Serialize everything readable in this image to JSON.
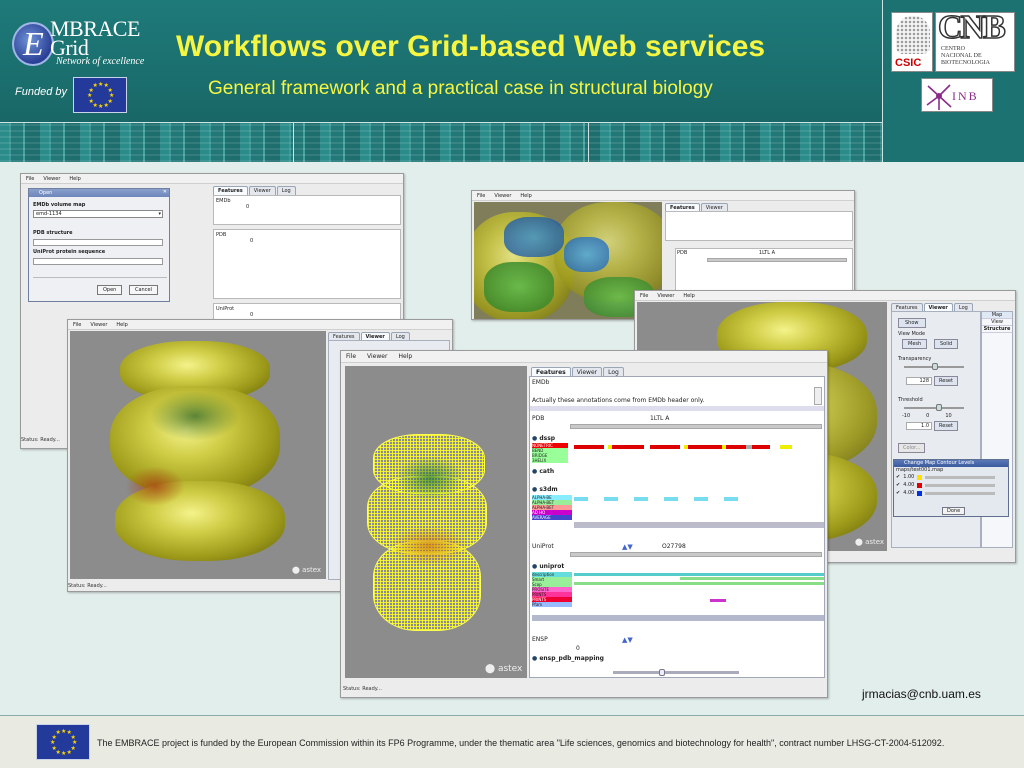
{
  "header": {
    "logo": {
      "title_line1": "MBRACE",
      "title_line2": "Grid",
      "tagline": "Network of excellence"
    },
    "funded_by": "Funded by",
    "title": "Workflows over Grid-based Web services",
    "subtitle": "General framework and a practical case in structural biology",
    "partner_logos": {
      "csic": "CSIC",
      "cnb_big": "CNB",
      "cnb_small": [
        "CENTRO",
        "NACIONAL DE",
        "BIOTECNOLOGIA"
      ],
      "inb": "INB"
    }
  },
  "menu": {
    "file": "File",
    "viewer": "Viewer",
    "help": "Help"
  },
  "tabs": {
    "features": "Features",
    "viewer": "Viewer",
    "log": "Log"
  },
  "status_text": "Status: Ready...",
  "astex_label": "astex",
  "open_dialog": {
    "title": "Open",
    "emdb_label": "EMDb volume map",
    "emdb_value": "emd-1134",
    "pdb_label": "PDB structure",
    "uniprot_label": "UniProt protein sequence",
    "open_button": "Open",
    "cancel_button": "Cancel"
  },
  "win1_panels": {
    "emdb": "EMDb",
    "pdb": "PDB",
    "uniprot": "UniProt",
    "zero": "0"
  },
  "features_panel": {
    "emdb_label": "EMDb",
    "emdb_note": "Actually these annotations come from EMDb header only.",
    "pdb_label": "PDB",
    "pdb_id": "1LTL A",
    "dssp": "dssp",
    "dssp_items": [
      "BEND",
      "BRIDGE",
      "3HELIX"
    ],
    "dssp_first": "NONETRIC",
    "cath": "cath",
    "s3dm": "s3dm",
    "s3dm_items": [
      "ALPHA-BE",
      "ALPHA-BET",
      "ALPHA-BET",
      "AD HO",
      "AVERAGE"
    ],
    "uniprot_label": "UniProt",
    "uniprot_id": "O27798",
    "uniprot_src": "uniprot",
    "uniprot_items": [
      "description",
      "Smart",
      "Scop",
      "PROSITE",
      "PRINTS",
      "PRINTS",
      "Pfam"
    ],
    "ensp_label": "ENSP",
    "ensp_value": "0",
    "ensp_mapping": "ensp_pdb_mapping"
  },
  "right_window": {
    "pdb_label": "PDB",
    "pdb_id": "1LTL A",
    "show": "Show",
    "view_mode": "View Mode",
    "mesh": "Mesh",
    "solid": "Solid",
    "transparency": "Transparency",
    "transparency_value": "128",
    "reset": "Reset",
    "threshold": "Threshold",
    "threshold_ticks": [
      "-10",
      "0",
      "10"
    ],
    "threshold_value": "1.0",
    "color_button": "Color...",
    "side_tabs": [
      "Map",
      "View",
      "Structure"
    ]
  },
  "contour_dialog": {
    "title": "Change Map Contour Levels",
    "file": "maps/test001.map",
    "levels": [
      "1.00",
      "4.00",
      "4.00"
    ],
    "done": "Done"
  },
  "email": "jrmacias@cnb.uam.es",
  "footer_note": "The EMBRACE project is funded by the European Commission within its FP6 Programme, under the thematic area \"Life sciences, genomics and biotechnology for health\", contract number LHSG-CT-2004-512092."
}
